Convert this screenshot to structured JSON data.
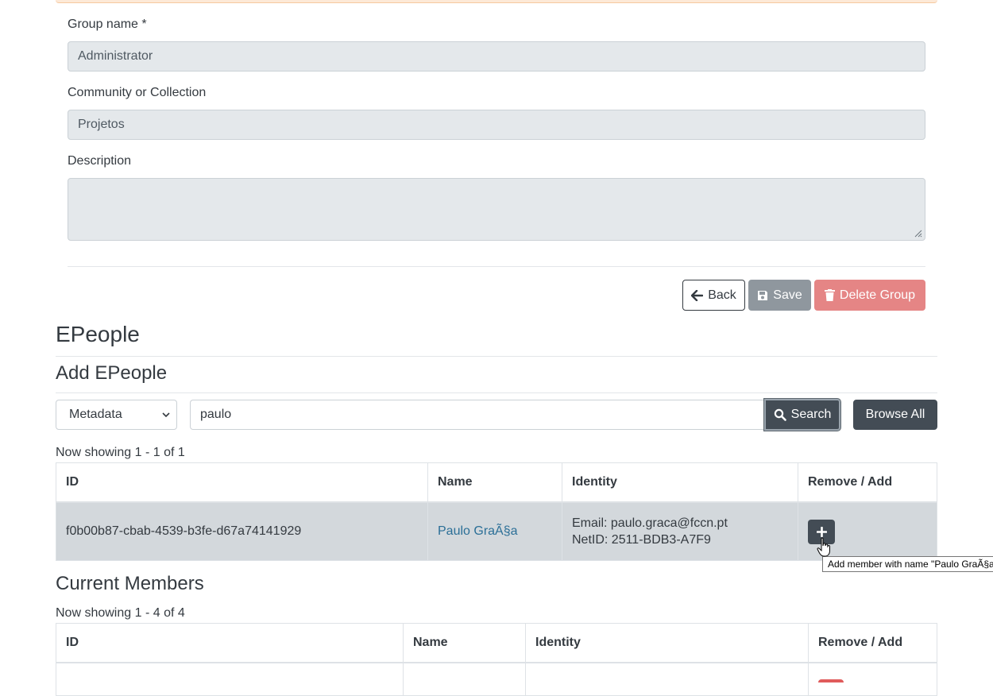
{
  "form": {
    "group_name_label": "Group name *",
    "group_name_value": "Administrator",
    "community_label": "Community or Collection",
    "community_value": "Projetos",
    "description_label": "Description",
    "description_value": ""
  },
  "actions": {
    "back_label": "Back",
    "save_label": "Save",
    "delete_label": "Delete Group"
  },
  "epeople": {
    "title": "EPeople",
    "add_title": "Add EPeople",
    "scope_selected": "Metadata",
    "search_value": "paulo",
    "search_label": "Search",
    "browse_label": "Browse All",
    "showing": "Now showing 1 - 1 of 1",
    "columns": [
      "ID",
      "Name",
      "Identity",
      "Remove / Add"
    ],
    "rows": [
      {
        "id": "f0b00b87-cbab-4539-b3fe-d67a74141929",
        "name": "Paulo GraÃ§a",
        "email": "Email: paulo.graca@fccn.pt",
        "netid": "NetID: 2511-BDB3-A7F9"
      }
    ],
    "tooltip": "Add member with name \"Paulo GraÃ§a"
  },
  "current": {
    "title": "Current Members",
    "showing": "Now showing 1 - 4 of 4",
    "columns": [
      "ID",
      "Name",
      "Identity",
      "Remove / Add"
    ]
  },
  "colors": {
    "dark_button": "#434c55",
    "delete_button": "#e58585",
    "link": "#2b6f97"
  }
}
